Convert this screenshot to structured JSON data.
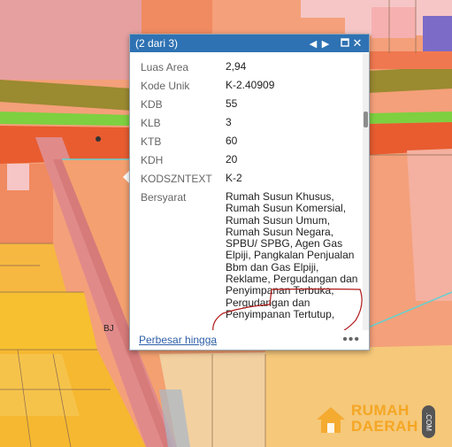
{
  "popup": {
    "title": "(2 dari 3)",
    "prev_icon": "previous-icon",
    "next_icon": "next-icon",
    "maximize_icon": "maximize-icon",
    "close_icon": "close-icon",
    "fields": [
      {
        "label": "Luas Area",
        "value": "2,94"
      },
      {
        "label": "Kode Unik",
        "value": "K-2.40909"
      },
      {
        "label": "KDB",
        "value": "55"
      },
      {
        "label": "KLB",
        "value": "3"
      },
      {
        "label": "KTB",
        "value": "60"
      },
      {
        "label": "KDH",
        "value": "20"
      },
      {
        "label": "KODSZNTEXT",
        "value": "K-2"
      },
      {
        "label": "Bersyarat",
        "value": "Rumah Susun Khusus, Rumah Susun Komersial, Rumah Susun Umum, Rumah Susun Negara, SPBU/ SPBG, Agen Gas Elpiji, Pangkalan Penjualan Bbm dan Gas Elpiji, Reklame, Pergudangan dan Penyimpanan Terbuka, Pergudangan dan Penyimpanan Tertutup,"
      }
    ],
    "zoom_link": "Perbesar hingga",
    "more_icon": "more-icon"
  },
  "map": {
    "label_bj": "BJ"
  },
  "watermark": {
    "line1": "RUMAH",
    "line2": "DAERAH",
    "suffix": ".COM"
  }
}
